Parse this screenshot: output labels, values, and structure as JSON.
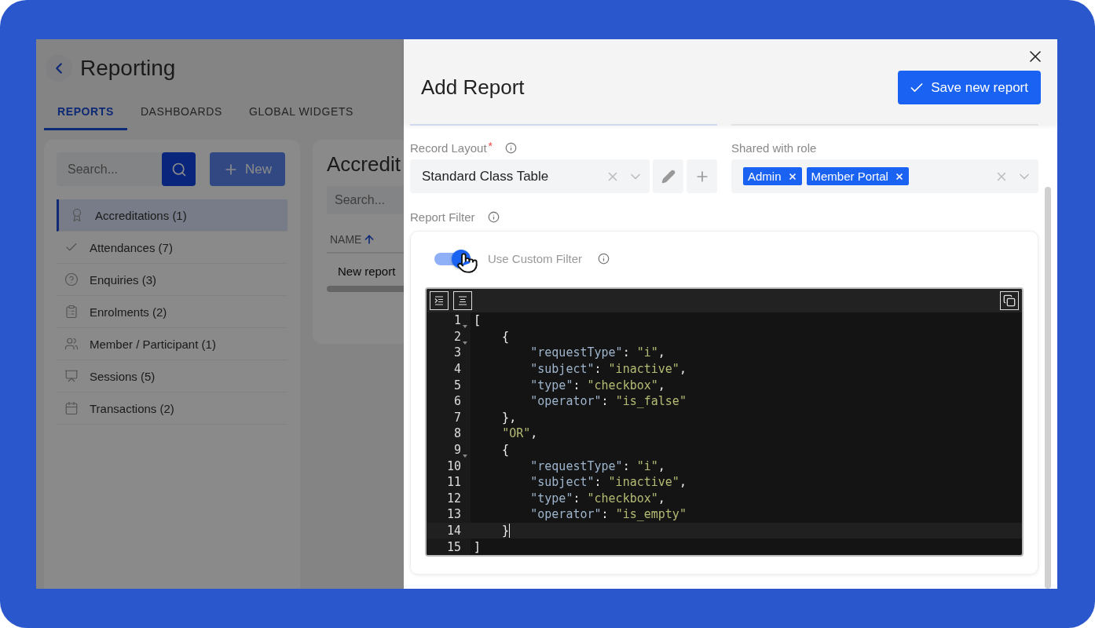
{
  "page": {
    "title": "Reporting",
    "tabs": [
      {
        "label": "REPORTS",
        "selected": true
      },
      {
        "label": "DASHBOARDS",
        "selected": false
      },
      {
        "label": "GLOBAL WIDGETS",
        "selected": false
      }
    ],
    "sidebar": {
      "search": {
        "placeholder": "Search..."
      },
      "new_button": "New",
      "items": [
        {
          "label": "Accreditations (1)",
          "selected": true
        },
        {
          "label": "Attendances (7)",
          "selected": false
        },
        {
          "label": "Enquiries (3)",
          "selected": false
        },
        {
          "label": "Enrolments (2)",
          "selected": false
        },
        {
          "label": "Member / Participant (1)",
          "selected": false
        },
        {
          "label": "Sessions (5)",
          "selected": false
        },
        {
          "label": "Transactions (2)",
          "selected": false
        }
      ]
    },
    "report_list": {
      "title": "Accredit",
      "search": {
        "placeholder": "Search..."
      },
      "columns": [
        {
          "label": "NAME"
        }
      ],
      "rows": [
        "New report"
      ]
    }
  },
  "drawer": {
    "title": "Add Report",
    "save_button": "Save new report",
    "record_layout": {
      "label": "Record Layout",
      "required_mark": "*",
      "value": "Standard Class Table"
    },
    "shared_with_role": {
      "label": "Shared with role",
      "tags": [
        "Admin",
        "Member Portal"
      ]
    },
    "report_filter": {
      "label": "Report Filter",
      "custom_filter": {
        "label": "Use Custom Filter",
        "on": true
      },
      "editor": {
        "lines": [
          {
            "number": "1",
            "text": "[",
            "foldable": true,
            "active": false
          },
          {
            "number": "2",
            "text": "    {",
            "foldable": true,
            "active": false
          },
          {
            "number": "3",
            "text": "        \"requestType\": \"i\",",
            "foldable": false,
            "active": false
          },
          {
            "number": "4",
            "text": "        \"subject\": \"inactive\",",
            "foldable": false,
            "active": false
          },
          {
            "number": "5",
            "text": "        \"type\": \"checkbox\",",
            "foldable": false,
            "active": false
          },
          {
            "number": "6",
            "text": "        \"operator\": \"is_false\"",
            "foldable": false,
            "active": false
          },
          {
            "number": "7",
            "text": "    },",
            "foldable": false,
            "active": false
          },
          {
            "number": "8",
            "text": "    \"OR\",",
            "foldable": false,
            "active": false
          },
          {
            "number": "9",
            "text": "    {",
            "foldable": true,
            "active": false
          },
          {
            "number": "10",
            "text": "        \"requestType\": \"i\",",
            "foldable": false,
            "active": false
          },
          {
            "number": "11",
            "text": "        \"subject\": \"inactive\",",
            "foldable": false,
            "active": false
          },
          {
            "number": "12",
            "text": "        \"type\": \"checkbox\",",
            "foldable": false,
            "active": false
          },
          {
            "number": "13",
            "text": "        \"operator\": \"is_empty\"",
            "foldable": false,
            "active": false
          },
          {
            "number": "14",
            "text": "    }",
            "foldable": false,
            "active": true
          },
          {
            "number": "15",
            "text": "]",
            "foldable": false,
            "active": false
          }
        ]
      }
    }
  }
}
